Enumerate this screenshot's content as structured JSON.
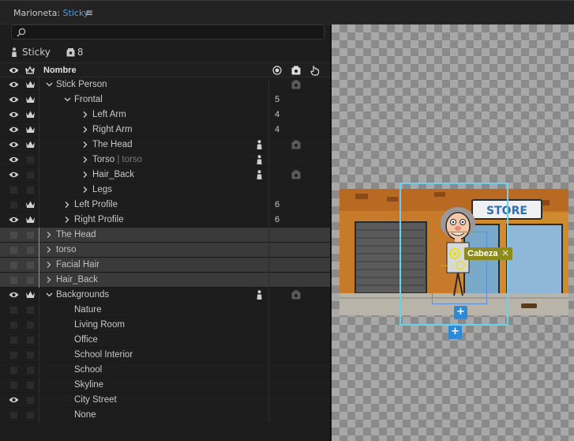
{
  "panel": {
    "title_prefix": "Marioneta:",
    "title_puppet": "Sticky",
    "menu_glyph": "≡"
  },
  "search": {
    "value": "",
    "placeholder": ""
  },
  "puppet": {
    "name": "Sticky",
    "count": "8"
  },
  "columns": {
    "name": "Nombre"
  },
  "rows": [
    {
      "label": "Stick Person",
      "indent": 0
    },
    {
      "label": "Frontal",
      "indent": 1,
      "num": "5"
    },
    {
      "label": "Left Arm",
      "indent": 2,
      "num": "4"
    },
    {
      "label": "Right Arm",
      "indent": 2,
      "num": "4"
    },
    {
      "label": "The Head",
      "indent": 2
    },
    {
      "label": "Torso",
      "sublabel": "torso",
      "indent": 2
    },
    {
      "label": "Hair_Back",
      "indent": 2
    },
    {
      "label": "Legs",
      "indent": 2
    },
    {
      "label": "Left Profile",
      "indent": 1,
      "num": "6"
    },
    {
      "label": "Right Profile",
      "indent": 1,
      "num": "6"
    },
    {
      "label": "The Head",
      "indent": 0
    },
    {
      "label": "torso",
      "indent": 0
    },
    {
      "label": "Facial Hair",
      "indent": 0
    },
    {
      "label": "Hair_Back",
      "indent": 0
    },
    {
      "label": "Backgrounds",
      "indent": 0
    },
    {
      "label": "Nature"
    },
    {
      "label": "Living Room"
    },
    {
      "label": "Office"
    },
    {
      "label": "School Interior"
    },
    {
      "label": "School"
    },
    {
      "label": "Skyline"
    },
    {
      "label": "City Street"
    },
    {
      "label": "None"
    }
  ],
  "canvas": {
    "handle_tag": "Cabeza",
    "plus_glyph": "+",
    "scene_sign": "STORE"
  },
  "colors": {
    "accent": "#4ea0e0",
    "bbox_outer": "#6fd0e6",
    "bbox_inner": "#5a8ee0",
    "handle_tag": "#8d8a1e",
    "selected_row_bar": "#b79a3a"
  }
}
